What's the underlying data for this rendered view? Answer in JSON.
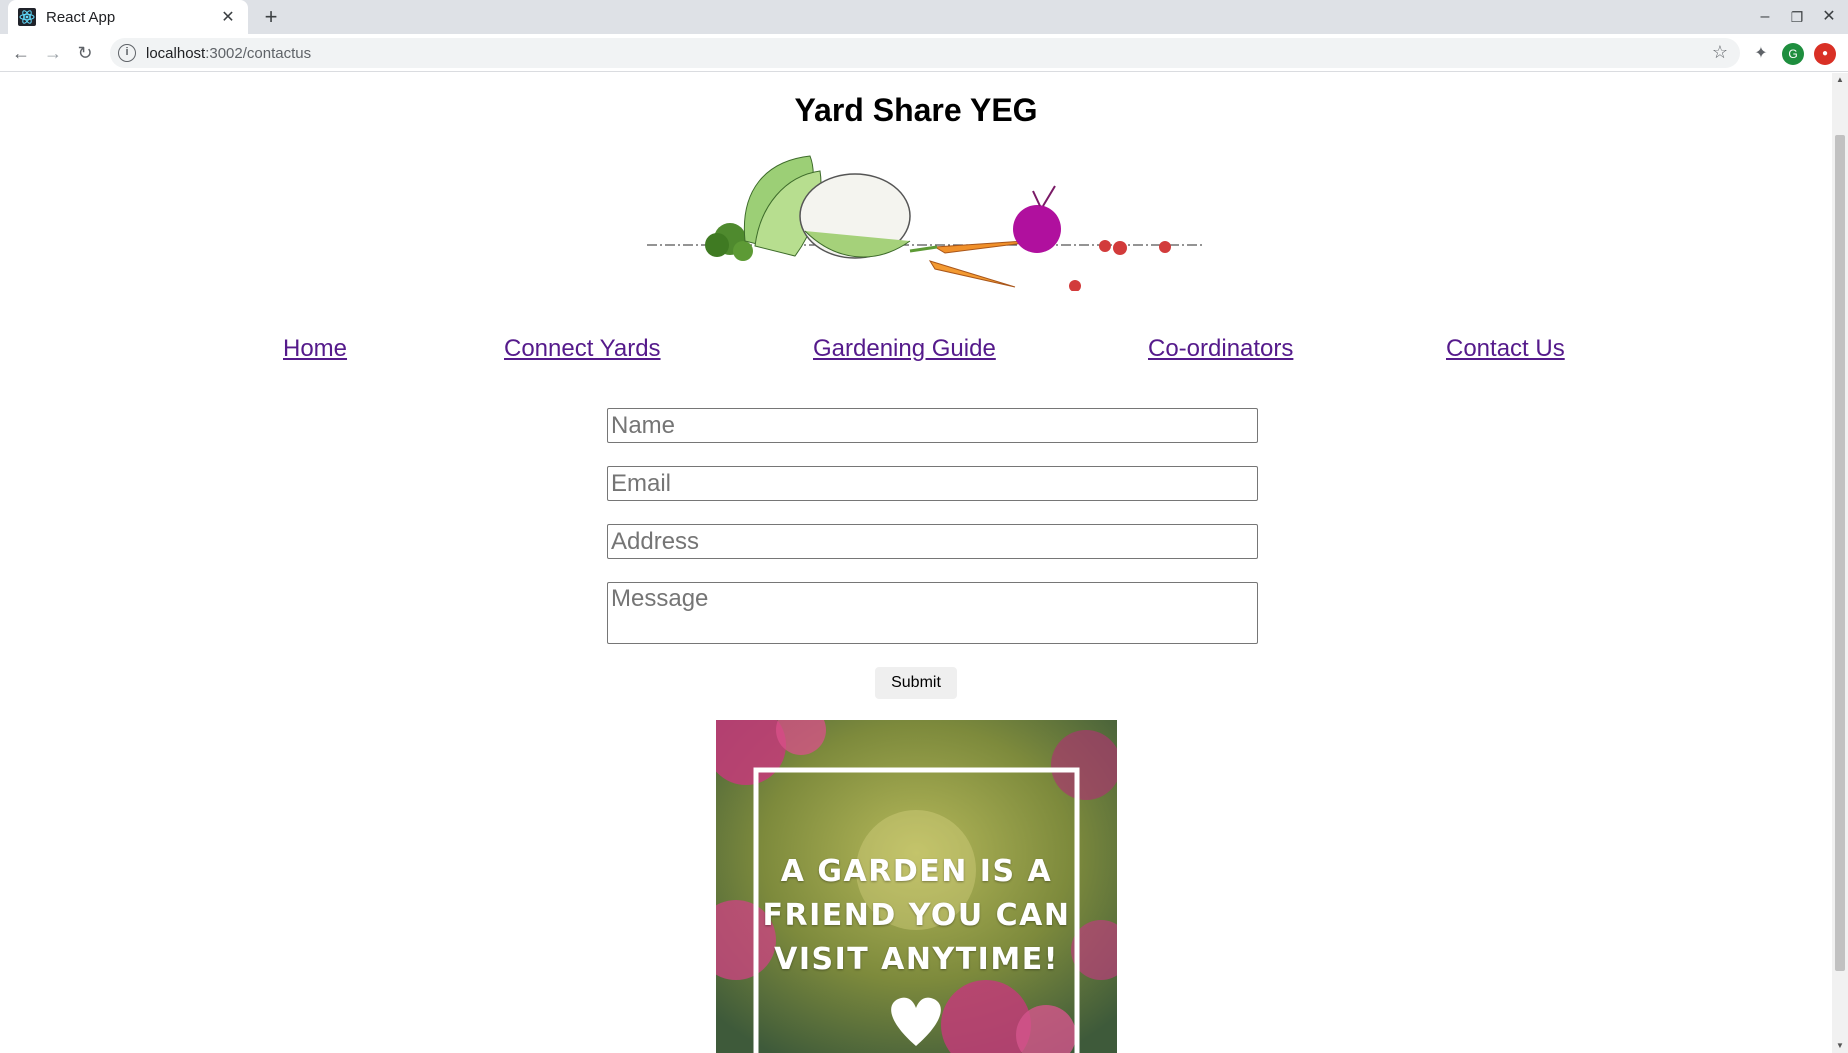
{
  "browser": {
    "tab_title": "React App",
    "url_host": "localhost",
    "url_path": ":3002/contactus",
    "profile_initial": "G"
  },
  "site": {
    "title": "Yard Share YEG"
  },
  "nav": {
    "items": [
      {
        "label": "Home"
      },
      {
        "label": "Connect Yards"
      },
      {
        "label": "Gardening Guide"
      },
      {
        "label": "Co-ordinators"
      },
      {
        "label": "Contact Us"
      }
    ]
  },
  "form": {
    "name_placeholder": "Name",
    "email_placeholder": "Email",
    "address_placeholder": "Address",
    "message_placeholder": "Message",
    "submit_label": "Submit"
  },
  "poster": {
    "line1": "A GARDEN IS A",
    "line2": "FRIEND YOU CAN",
    "line3": "VISIT ANYTIME!"
  },
  "colors": {
    "link_visited": "#551a8b",
    "tabbar": "#dee1e6",
    "profile": "#1e8e3e",
    "extension_red": "#d93025"
  }
}
